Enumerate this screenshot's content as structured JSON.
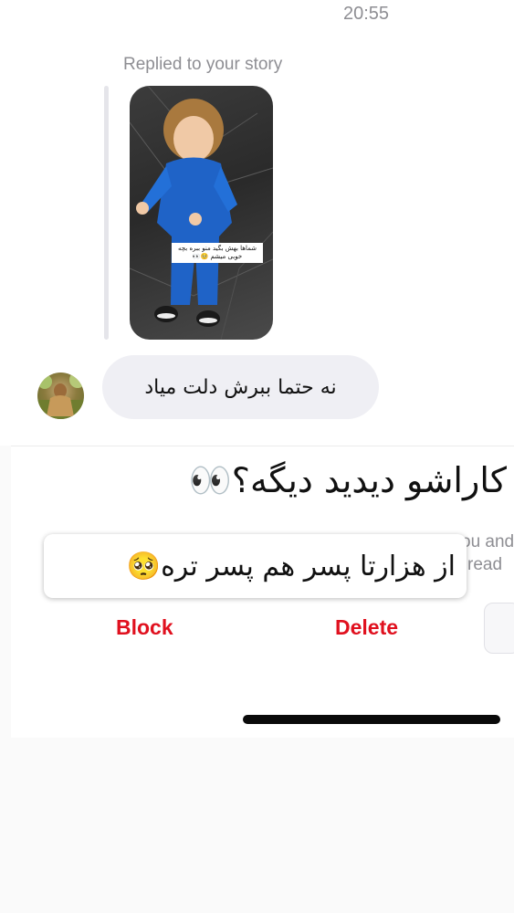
{
  "status": {
    "time": "20:55"
  },
  "thread": {
    "reply_label": "Replied to your story",
    "story_caption": "شماها بهش بگید منو ببره بچه خوبی میشم 🥺👀",
    "message": "نه حتما ببرش دلت میاد"
  },
  "overlay": {
    "headline": "کاراشو دیدید دیگه؟👀",
    "quote": "از هزارتا پسر هم پسر تره🥺",
    "faded_line_1": "ou and",
    "faded_line_2": "read"
  },
  "actions": {
    "block_label": "Block",
    "delete_label": "Delete"
  },
  "colors": {
    "destructive": "#e0101e",
    "bubble": "#efeff4",
    "meta_text": "#8e8e93"
  }
}
